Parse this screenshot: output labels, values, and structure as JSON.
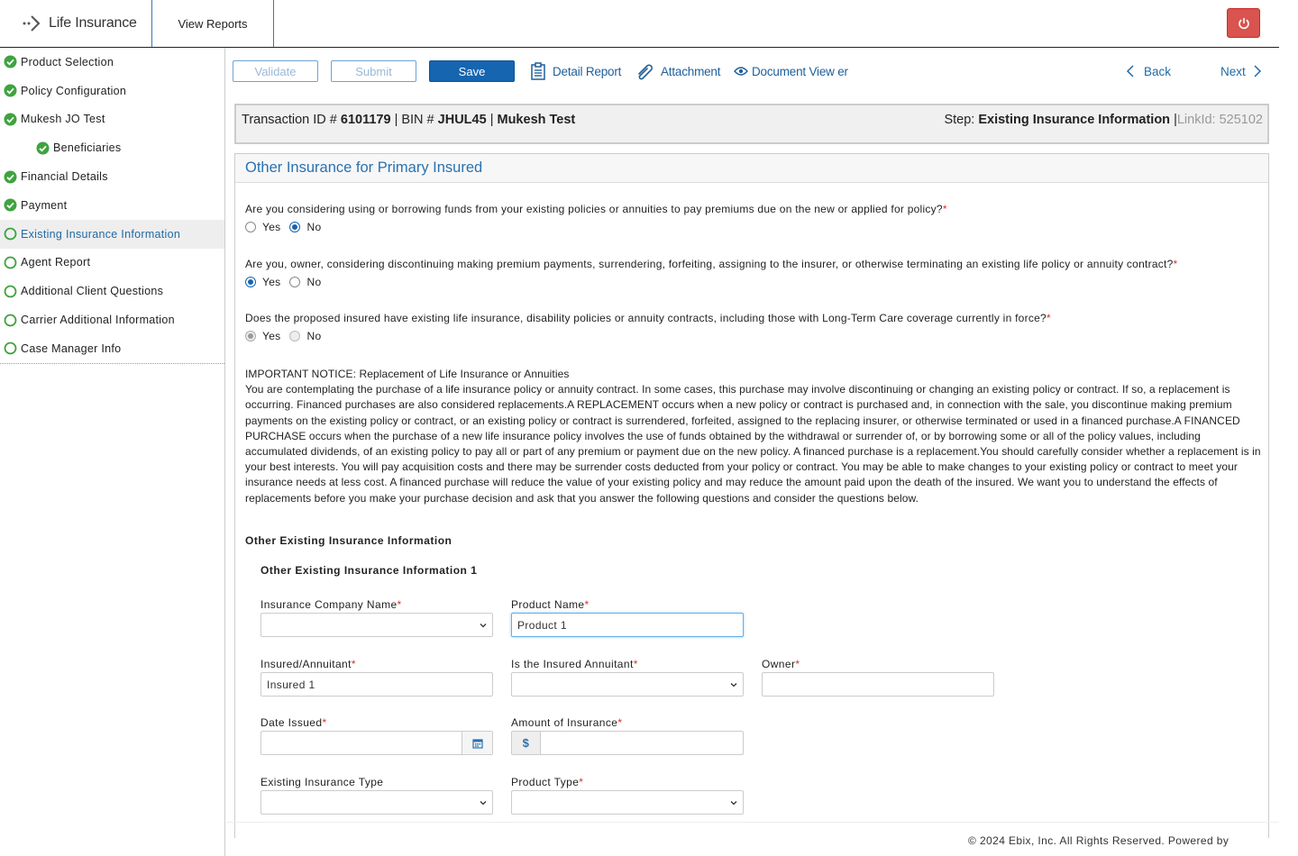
{
  "header": {
    "brand": "Life Insurance",
    "view_reports": "View Reports"
  },
  "sidebar": {
    "items": [
      {
        "label": "Product Selection",
        "status": "complete"
      },
      {
        "label": "Policy Configuration",
        "status": "complete"
      },
      {
        "label": "Mukesh JO Test",
        "status": "complete"
      },
      {
        "label": "Beneficiaries",
        "status": "complete"
      },
      {
        "label": "Financial Details",
        "status": "complete"
      },
      {
        "label": "Payment",
        "status": "complete"
      },
      {
        "label": "Existing Insurance Information",
        "status": "current"
      },
      {
        "label": "Agent Report",
        "status": "pending"
      },
      {
        "label": "Additional Client Questions",
        "status": "pending"
      },
      {
        "label": "Carrier Additional Information",
        "status": "pending"
      },
      {
        "label": "Case Manager Info",
        "status": "pending"
      }
    ]
  },
  "toolbar": {
    "validate": "Validate",
    "submit": "Submit",
    "save": "Save",
    "detail_report": "Detail Report",
    "attachment": "Attachment",
    "document_viewer": "Document View er",
    "back": "Back",
    "next": "Next"
  },
  "transaction": {
    "txn_label": "Transaction ID #",
    "txn_id": "6101179",
    "bin_label": "| BIN #",
    "bin": "JHUL45",
    "sep": "|",
    "name": "Mukesh Test",
    "step_label": "Step:",
    "step": "Existing Insurance Information",
    "link_sep": "|",
    "link_label": "LinkId:",
    "link_id": "525102"
  },
  "panel": {
    "title": "Other Insurance for Primary Insured",
    "q1": "Are you considering using or borrowing funds from your existing policies or annuities to pay premiums due on the new or applied for policy?",
    "q2": "Are you, owner, considering discontinuing making premium payments, surrendering, forfeiting, assigning to the insurer, or otherwise terminating an existing life policy or annuity contract?",
    "q3": "Does the proposed insured have existing life insurance, disability policies or annuity contracts, including those with Long-Term Care coverage currently in force?",
    "yes": "Yes",
    "no": "No",
    "q1_answer": "No",
    "q2_answer": "Yes",
    "q3_answer": "Yes",
    "notice_title": "IMPORTANT NOTICE: Replacement of Life Insurance or Annuities",
    "notice_body": "You are contemplating the purchase of a life insurance policy or annuity contract. In some cases, this purchase may involve discontinuing or changing an existing policy or contract. If so, a replacement is occurring. Financed purchases are also considered replacements.A REPLACEMENT occurs when a new policy or contract is purchased and, in connection with the sale, you discontinue making premium payments on the existing policy or contract, or an existing policy or contract is surrendered, forfeited, assigned to the replacing insurer, or otherwise terminated or used in a financed purchase.A FINANCED PURCHASE occurs when the purchase of a new life insurance policy involves the use of funds obtained by the withdrawal or surrender of, or by borrowing some or all of the policy values, including accumulated dividends, of an existing policy to pay all or part of any premium or payment due on the new policy. A financed purchase is a replacement.You should carefully consider whether a replacement is in your best interests. You will pay acquisition costs and there may be surrender costs deducted from your policy or contract. You may be able to make changes to your existing policy or contract to meet your insurance needs at less cost. A financed purchase will reduce the value of your existing policy and may reduce the amount paid upon the death of the insured. We want you to understand the effects of replacements before you make your purchase decision and ask that you answer the following questions and consider the questions below.",
    "section_title": "Other Existing Insurance Information",
    "sub_title": "Other Existing Insurance Information 1"
  },
  "form": {
    "company_label": "Insurance Company Name",
    "company_value": "",
    "product_label": "Product Name",
    "product_value": "Product 1",
    "insured_label": "Insured/Annuitant",
    "insured_value": "Insured 1",
    "is_annuitant_label": "Is the Insured Annuitant",
    "is_annuitant_value": "",
    "owner_label": "Owner",
    "owner_value": "",
    "date_label": "Date Issued",
    "date_value": "",
    "amount_label": "Amount of Insurance",
    "amount_prefix": "$",
    "amount_value": "",
    "existing_type_label": "Existing Insurance Type",
    "existing_type_value": "",
    "product_type_label": "Product Type",
    "product_type_value": "",
    "required_mark": "*"
  },
  "footer": {
    "copyright": "© 2024 Ebix, Inc. All Rights Reserved. Powered by"
  },
  "colors": {
    "accent": "#1565b0",
    "complete": "#3fa33f",
    "danger": "#d9534f"
  }
}
